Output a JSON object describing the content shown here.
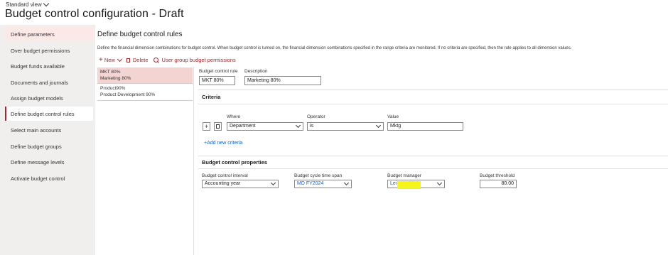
{
  "header": {
    "view_label": "Standard view",
    "title": "Budget control configuration - Draft"
  },
  "nav": {
    "items": [
      {
        "label": "Define parameters",
        "state": "highlighted"
      },
      {
        "label": "Over budget permissions",
        "state": "normal"
      },
      {
        "label": "Budget funds available",
        "state": "normal"
      },
      {
        "label": "Documents and journals",
        "state": "normal"
      },
      {
        "label": "Assign budget models",
        "state": "normal"
      },
      {
        "label": "Define budget control rules",
        "state": "active"
      },
      {
        "label": "Select main accounts",
        "state": "normal"
      },
      {
        "label": "Define budget groups",
        "state": "normal"
      },
      {
        "label": "Define message levels",
        "state": "normal"
      },
      {
        "label": "Activate budget control",
        "state": "normal"
      }
    ]
  },
  "main": {
    "title": "Define budget control rules",
    "description": "Define the financial dimension combinations for budget control. When budget control is turned on, the financial dimension combinations specified in the range criteria are monitored. If no criteria are specified, then the rule applies to all dimension values.",
    "toolbar": {
      "new_label": "New",
      "delete_label": "Delete",
      "permissions_label": "User group budget permissions"
    },
    "rules": [
      {
        "code": "MKT 80%",
        "name": "Marketing 80%"
      },
      {
        "code": "Product90%",
        "name": "Product Development 90%"
      }
    ],
    "detail": {
      "rule_label": "Budget control rule",
      "rule_value": "MKT 80%",
      "description_label": "Description",
      "description_value": "Marketing 80%"
    },
    "criteria": {
      "title": "Criteria",
      "where_label": "Where",
      "operator_label": "Operator",
      "value_label": "Value",
      "row": {
        "where": "Department",
        "operator": "is",
        "value": "Mktg"
      },
      "add_label": "+Add new criteria"
    },
    "properties": {
      "title": "Budget control properties",
      "interval_label": "Budget control interval",
      "interval_value": "Accounting year",
      "cycle_label": "Budget cycle time span",
      "cycle_value": "MD FY2024",
      "manager_label": "Budget manager",
      "manager_value": "Lei",
      "threshold_label": "Budget threshold",
      "threshold_value": "80.00"
    }
  },
  "colors": {
    "accent": "#a4262c",
    "link": "#1b5fb4",
    "nav_bg": "#f0efee",
    "selected_row": "#f4d4d2",
    "redaction": "#f5f517"
  }
}
